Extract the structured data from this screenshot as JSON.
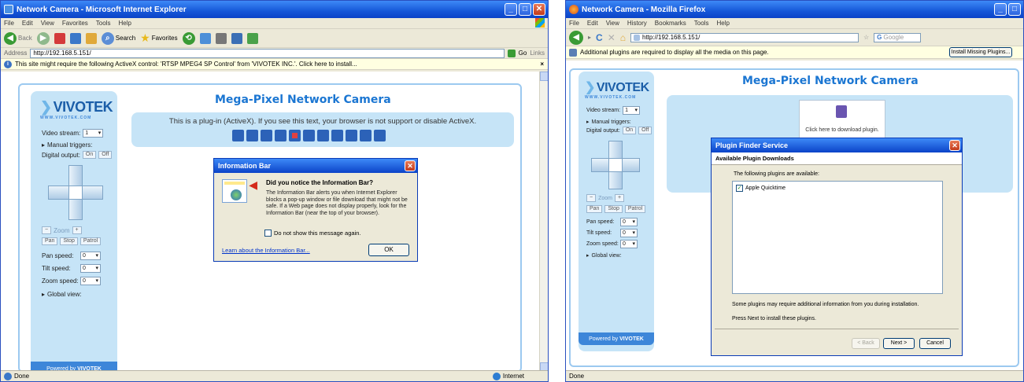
{
  "ie": {
    "title": "Network Camera - Microsoft Internet Explorer",
    "menu": [
      "File",
      "Edit",
      "View",
      "Favorites",
      "Tools",
      "Help"
    ],
    "toolbar": {
      "back": "Back",
      "search": "Search",
      "favorites": "Favorites"
    },
    "address_label": "Address",
    "url": "http://192.168.5.151/",
    "go": "Go",
    "links": "Links",
    "infobar": "This site might require the following ActiveX control: 'RTSP MPEG4 SP Control' from 'VIVOTEK INC.'. Click here to install...",
    "status_left": "Done",
    "status_right": "Internet",
    "page": {
      "logo": "VIVOTEK",
      "logo_sub": "WWW.VIVOTEK.COM",
      "title": "Mega-Pixel Network Camera",
      "video_stream_label": "Video stream:",
      "video_stream_value": "1",
      "manual_triggers": "Manual triggers:",
      "digital_output": "Digital output:",
      "on": "On",
      "off": "Off",
      "zoom": "Zoom",
      "zoom_minus": "−",
      "zoom_plus": "+",
      "pan": "Pan",
      "stop": "Stop",
      "patrol": "Patrol",
      "pan_speed": "Pan speed:",
      "tilt_speed": "Tilt speed:",
      "zoom_speed": "Zoom speed:",
      "speed_value": "0",
      "global_view": "Global view:",
      "powered_by": "Powered by",
      "powered_logo": "VIVOTEK",
      "plugin_message": "This is a plug-in (ActiveX). If you see this text, your browser is not support or disable ActiveX."
    },
    "dialog": {
      "title": "Information Bar",
      "heading": "Did you notice the Information Bar?",
      "body": "The Information Bar alerts you when Internet Explorer blocks a pop-up window or file download that might not be safe. If a Web page does not display properly, look for the Information Bar (near the top of your browser).",
      "checkbox_label": "Do not show this message again.",
      "link": "Learn about the Information Bar...",
      "ok": "OK"
    }
  },
  "ff": {
    "title": "Network Camera - Mozilla Firefox",
    "menu": [
      "File",
      "Edit",
      "View",
      "History",
      "Bookmarks",
      "Tools",
      "Help"
    ],
    "url": "http://192.168.5.151/",
    "search_engine": "Google",
    "infobar": "Additional plugins are required to display all the media on this page.",
    "install_button": "Install Missing Plugins...",
    "status_left": "Done",
    "page": {
      "logo": "VIVOTEK",
      "logo_sub": "WWW.VIVOTEK.COM",
      "title": "Mega-Pixel Network Camera",
      "video_stream_label": "Video stream:",
      "video_stream_value": "1",
      "manual_triggers": "Manual triggers:",
      "digital_output": "Digital output:",
      "on": "On",
      "off": "Off",
      "zoom": "Zoom",
      "zoom_minus": "−",
      "zoom_plus": "+",
      "pan": "Pan",
      "stop": "Stop",
      "patrol": "Patrol",
      "pan_speed": "Pan speed:",
      "tilt_speed": "Tilt speed:",
      "zoom_speed": "Zoom speed:",
      "speed_value": "0",
      "global_view": "Global view:",
      "powered_by": "Powered by",
      "powered_logo": "VIVOTEK",
      "download_plugin": "Click here to download plugin."
    },
    "dialog": {
      "title": "Plugin Finder Service",
      "subtitle": "Available Plugin Downloads",
      "intro": "The following plugins are available:",
      "plugin_item": "Apple Quicktime",
      "note": "Some plugins may require additional information from you during installation.",
      "press_next": "Press Next to install these plugins.",
      "back": "< Back",
      "next": "Next >",
      "cancel": "Cancel"
    }
  },
  "colors": {
    "xp_title_blue": "#0b43c8",
    "vivotek_blue": "#1b76d2",
    "panel_blue": "#c6e4f7",
    "infobar_yellow": "#ffffe1"
  }
}
